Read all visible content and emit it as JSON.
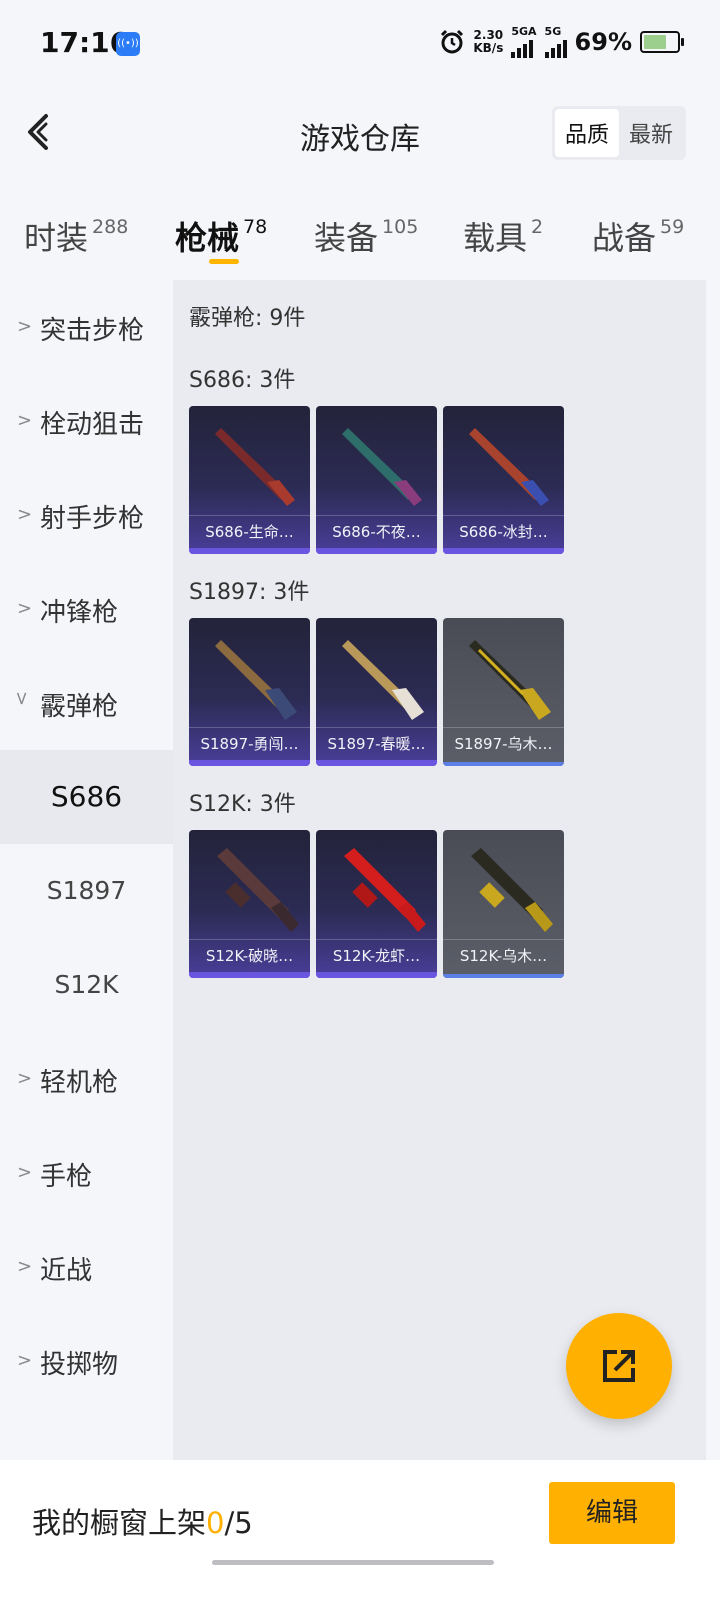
{
  "status_bar": {
    "time": "17:16",
    "net_speed_value": "2.30",
    "net_speed_unit": "KB/s",
    "net1": "5GA",
    "net2": "5G",
    "battery": "69%"
  },
  "header": {
    "title": "游戏仓库",
    "sort_options": [
      "品质",
      "最新"
    ],
    "active_sort": "品质"
  },
  "tabs": [
    {
      "label": "时装",
      "count": "288"
    },
    {
      "label": "枪械",
      "count": "78"
    },
    {
      "label": "装备",
      "count": "105"
    },
    {
      "label": "载具",
      "count": "2"
    },
    {
      "label": "战备",
      "count": "59"
    }
  ],
  "active_tab": "枪械",
  "sidebar": {
    "categories": [
      "突击步枪",
      "栓动狙击",
      "射手步枪",
      "冲锋枪",
      "霰弹枪",
      "轻机枪",
      "手枪",
      "近战",
      "投掷物"
    ],
    "expanded": "霰弹枪",
    "subcategories": [
      "S686",
      "S1897",
      "S12K"
    ],
    "active_sub": "S686"
  },
  "content": {
    "summary": "霰弹枪: 9件",
    "groups": [
      {
        "title": "S686: 3件",
        "items": [
          {
            "name": "S686-生命…",
            "rarity": "purple"
          },
          {
            "name": "S686-不夜…",
            "rarity": "purple"
          },
          {
            "name": "S686-冰封…",
            "rarity": "purple"
          }
        ]
      },
      {
        "title": "S1897: 3件",
        "items": [
          {
            "name": "S1897-勇闯…",
            "rarity": "purple"
          },
          {
            "name": "S1897-春暖…",
            "rarity": "purple"
          },
          {
            "name": "S1897-乌木…",
            "rarity": "grey"
          }
        ]
      },
      {
        "title": "S12K: 3件",
        "items": [
          {
            "name": "S12K-破晓…",
            "rarity": "purple"
          },
          {
            "name": "S12K-龙虾…",
            "rarity": "purple"
          },
          {
            "name": "S12K-乌木…",
            "rarity": "grey"
          }
        ]
      }
    ]
  },
  "bottom": {
    "shelf_label": "我的橱窗上架",
    "shelf_current": "0",
    "shelf_total": "/5",
    "edit_label": "编辑"
  },
  "colors": {
    "accent": "#ffb000",
    "rare_purple": "#6a55e0",
    "common_grey": "#5b5e68"
  }
}
